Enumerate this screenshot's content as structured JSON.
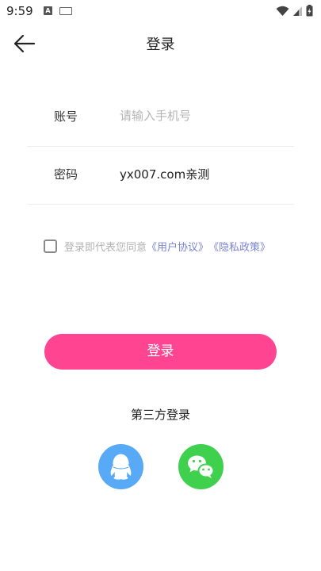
{
  "status_bar": {
    "time": "9:59",
    "notif_a": "A"
  },
  "header": {
    "title": "登录"
  },
  "form": {
    "account_label": "账号",
    "account_placeholder": "请输入手机号",
    "password_label": "密码",
    "password_value": "yx007.com亲测"
  },
  "agreement": {
    "text": "登录即代表您同意",
    "user_agreement": "《用户协议》",
    "privacy_policy": "《隐私政策》"
  },
  "login_button": {
    "label": "登录"
  },
  "third_party": {
    "title": "第三方登录"
  },
  "colors": {
    "primary": "#ff4591",
    "link": "#7a83d6",
    "qq": "#58a9f6",
    "wechat": "#3fd14d"
  },
  "icons": {
    "back": "arrow-left-icon",
    "qq": "qq-icon",
    "wechat": "wechat-icon"
  }
}
